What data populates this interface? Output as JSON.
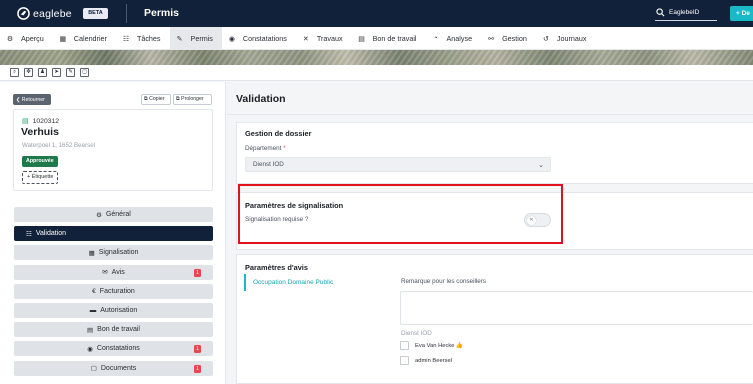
{
  "header": {
    "brand": "eaglebe",
    "beta": "BETA",
    "app_title": "Permis",
    "search_value": "EaglebeID",
    "add_label": "+ De"
  },
  "nav": {
    "tabs": [
      {
        "label": "Aperçu",
        "icon": "gear-icon",
        "glyph": "⚙"
      },
      {
        "label": "Calendrier",
        "icon": "calendar-icon",
        "glyph": "▦"
      },
      {
        "label": "Tâches",
        "icon": "checklist-icon",
        "glyph": "☷"
      },
      {
        "label": "Permis",
        "icon": "permit-icon",
        "glyph": "✎"
      },
      {
        "label": "Constatations",
        "icon": "eye-icon",
        "glyph": "◉"
      },
      {
        "label": "Travaux",
        "icon": "roadwork-icon",
        "glyph": "✕"
      },
      {
        "label": "Bon de travail",
        "icon": "document-icon",
        "glyph": "▤"
      },
      {
        "label": "Analyse",
        "icon": "chart-icon",
        "glyph": "◔"
      },
      {
        "label": "Gestion",
        "icon": "settings-icon",
        "glyph": "⚯"
      },
      {
        "label": "Journaux",
        "icon": "history-icon",
        "glyph": "↺"
      }
    ],
    "active_tab": "Permis"
  },
  "map_tools": [
    {
      "icon": "zoom-icon",
      "glyph": "⌕"
    },
    {
      "icon": "move-icon",
      "glyph": "✥"
    },
    {
      "icon": "person-icon",
      "glyph": "♟"
    },
    {
      "icon": "pointer-icon",
      "glyph": "➤"
    },
    {
      "icon": "pencil-icon",
      "glyph": "✎"
    },
    {
      "icon": "square-icon",
      "glyph": "◻"
    }
  ],
  "left": {
    "back_label": "❮ Retourner",
    "copy_label": "⧉ Copier",
    "extend_label": "⧉ Prolonger",
    "dossier": {
      "id": "1020312",
      "name": "Verhuis",
      "address": "Waterpoel 1, 1652 Beersel",
      "status": "Approuvée",
      "tag_button": "+ Étiquette"
    },
    "menu": [
      {
        "label": "Général",
        "glyph": "⚙",
        "icon": "gear-icon",
        "badge": ""
      },
      {
        "label": "Validation",
        "glyph": "☷",
        "icon": "checklist-icon",
        "badge": "",
        "active": true
      },
      {
        "label": "Signalisation",
        "glyph": "▦",
        "icon": "signage-icon",
        "badge": ""
      },
      {
        "label": "Avis",
        "glyph": "✉",
        "icon": "comment-icon",
        "badge": "1"
      },
      {
        "label": "Facturation",
        "glyph": "€",
        "icon": "euro-icon",
        "badge": ""
      },
      {
        "label": "Autorisation",
        "glyph": "▬",
        "icon": "authorization-icon",
        "badge": ""
      },
      {
        "label": "Bon de travail",
        "glyph": "▤",
        "icon": "document-icon",
        "badge": ""
      },
      {
        "label": "Constatations",
        "glyph": "◉",
        "icon": "eye-icon",
        "badge": "1"
      },
      {
        "label": "Documents",
        "glyph": "▢",
        "icon": "file-icon",
        "badge": "1"
      }
    ]
  },
  "main": {
    "title": "Validation",
    "gestion": {
      "title": "Gestion de dossier",
      "dept_label": "Département",
      "dept_required": "*",
      "dept_value": "Dienst IOD"
    },
    "signalisation": {
      "title": "Paramètres de signalisation",
      "question": "Signalisation requise ?",
      "toggle_on": false
    },
    "avis": {
      "title": "Paramètres d'avis",
      "subtab": "Occupation Domaine Public",
      "remark_label": "Remarque pour les conseillers",
      "group": "Dienst IOD",
      "people": [
        {
          "name": "Eva Van Hecke",
          "approved": true
        },
        {
          "name": "admin Beersel",
          "approved": false
        }
      ]
    }
  },
  "colors": {
    "topbar": "#12213a",
    "accent": "#19b9c8",
    "approved": "#1e7a4a",
    "badge": "#e5484d",
    "highlight": "#e0121b"
  }
}
